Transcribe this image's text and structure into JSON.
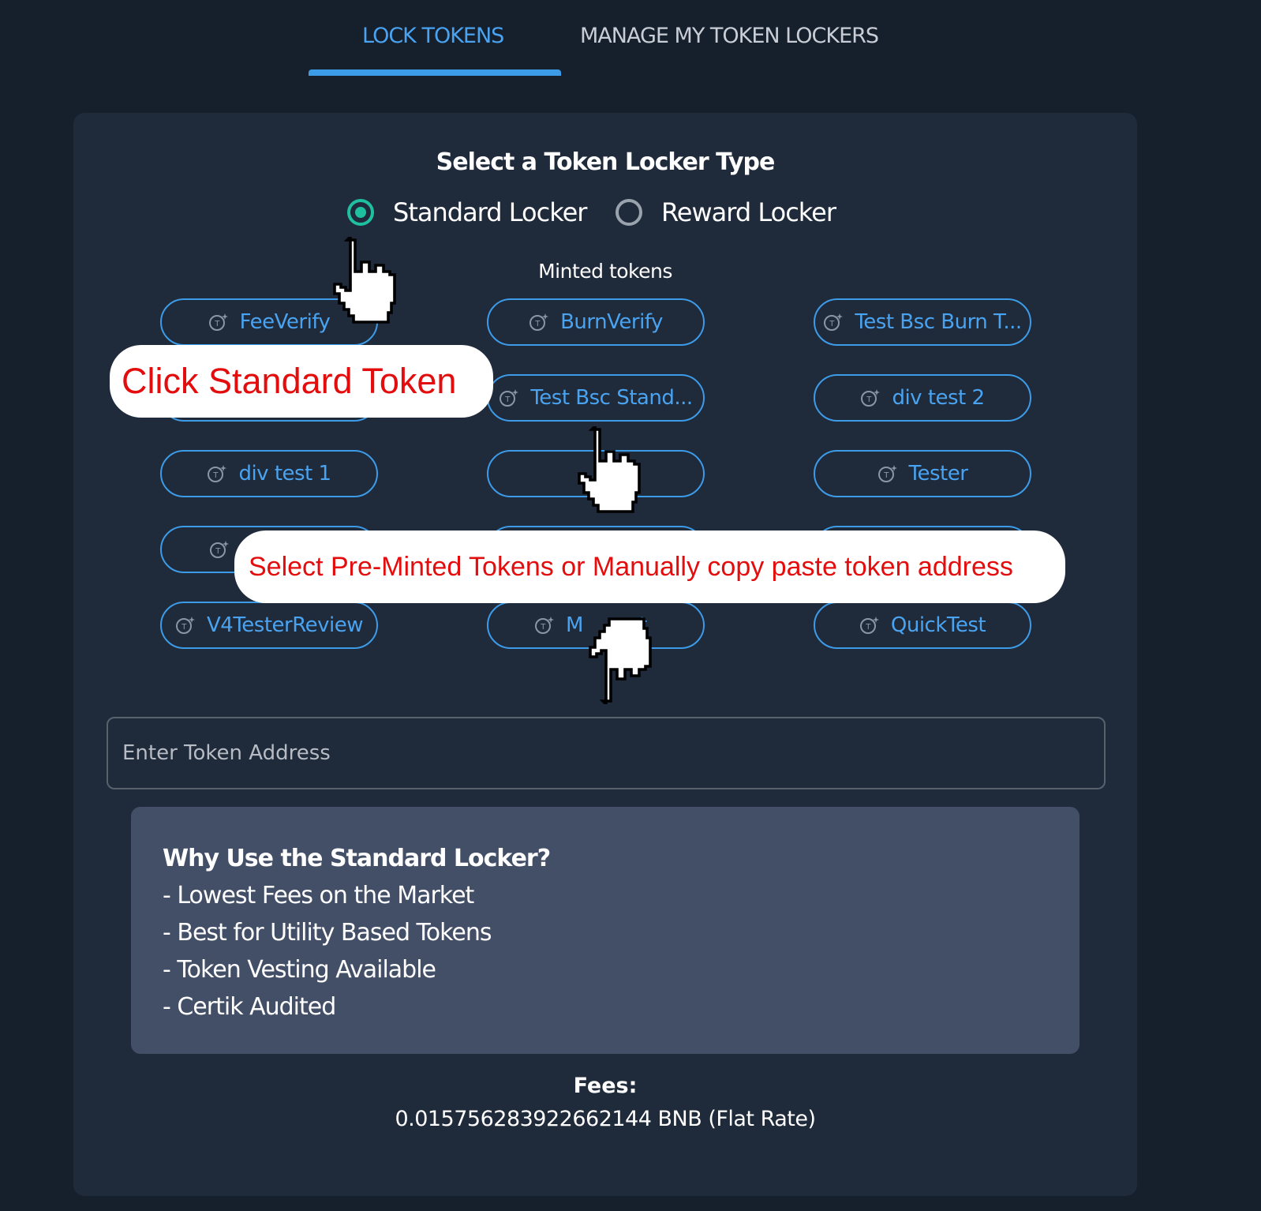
{
  "tabs": [
    {
      "label": "LOCK TOKENS",
      "active": true
    },
    {
      "label": "MANAGE MY TOKEN LOCKERS",
      "active": false
    }
  ],
  "locker_section": {
    "title": "Select a Token Locker Type",
    "options": [
      {
        "label": "Standard Locker",
        "selected": true
      },
      {
        "label": "Reward Locker",
        "selected": false
      }
    ]
  },
  "minted_tokens": {
    "label": "Minted tokens",
    "items": [
      "FeeVerify",
      "BurnVerify",
      "Test Bsc Burn T...",
      "",
      "Test Bsc Stand...",
      "div test 2",
      "div test 1",
      "",
      "Tester",
      "",
      "",
      "",
      "V4TesterReview",
      "M",
      "QuickTest"
    ],
    "item_8_partial_suffix": "st"
  },
  "token_address": {
    "placeholder": "Enter Token Address",
    "value": ""
  },
  "info_box": {
    "title": "Why Use the Standard Locker?",
    "lines": [
      "- Lowest Fees on the Market",
      "- Best for Utility Based Tokens",
      "- Token Vesting Available",
      "- Certik Audited"
    ]
  },
  "fees": {
    "label": "Fees:",
    "value": "0.015756283922662144 BNB (Flat Rate)"
  },
  "annotations": {
    "callout_1": "Click Standard Token",
    "callout_2": "Select Pre-Minted Tokens or Manually copy paste token address"
  },
  "colors": {
    "background": "#161f2c",
    "panel": "#1f2a3a",
    "accent_blue": "#3d9ce8",
    "radio_selected": "#1fc0a0",
    "info_box": "#434f67",
    "callout_text": "#e30d0d"
  },
  "icons": {
    "token": "token-sparkle-icon",
    "cursor": "hand-pointer-icon"
  }
}
